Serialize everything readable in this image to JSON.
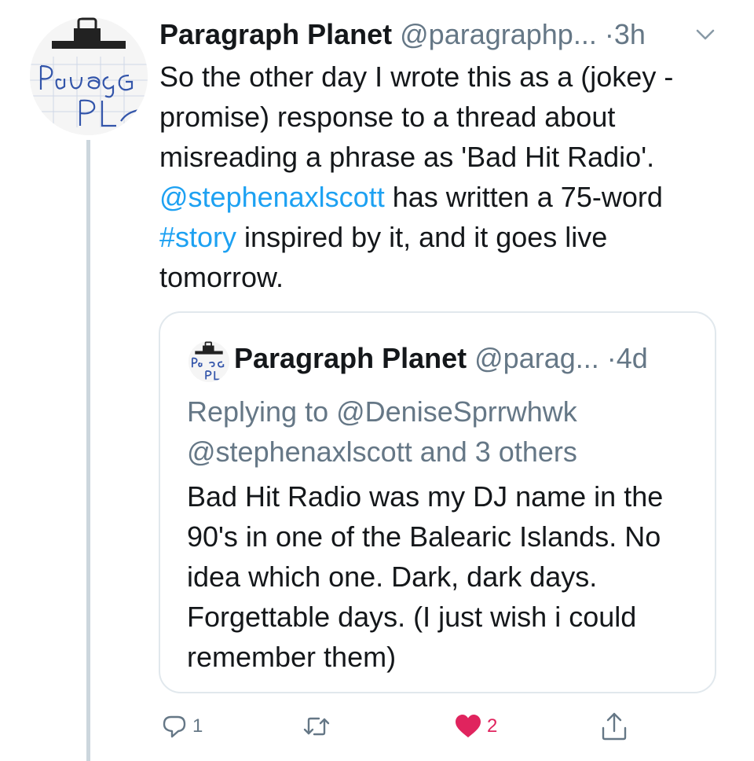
{
  "tweet": {
    "author_name": "Paragraph Planet",
    "author_handle": "@paragraphp...",
    "separator": "·",
    "time": "3h",
    "text_1": "So the other day I wrote this as a (jokey - promise) response to a thread about misreading a phrase as 'Bad Hit Radio'. ",
    "mention": "@stephenaxlscott",
    "text_2": " has written a 75-word ",
    "hashtag": "#story",
    "text_3": " inspired by it, and it goes live tomorrow.",
    "avatar_text": "Parag PL"
  },
  "quoted": {
    "author_name": "Paragraph Planet",
    "author_handle": "@parag...",
    "separator": "·",
    "time": "4d",
    "reply_text": "Replying to @DeniseSprrwhwk @stephenaxlscott and 3 others",
    "text": "Bad Hit Radio was my DJ name in the 90's in one of the Balearic Islands. No idea which one. Dark, dark days. Forgettable days. (I just wish i could remember them)"
  },
  "actions": {
    "reply_count": "1",
    "retweet_count": "",
    "like_count": "2",
    "share_count": ""
  },
  "colors": {
    "link": "#1da1f2",
    "secondary_text": "#657786",
    "like_active": "#e0245e",
    "border": "#e1e8ed"
  },
  "icons": [
    "avatar",
    "chevron-down-icon",
    "reply-icon",
    "retweet-icon",
    "heart-icon",
    "share-icon"
  ]
}
